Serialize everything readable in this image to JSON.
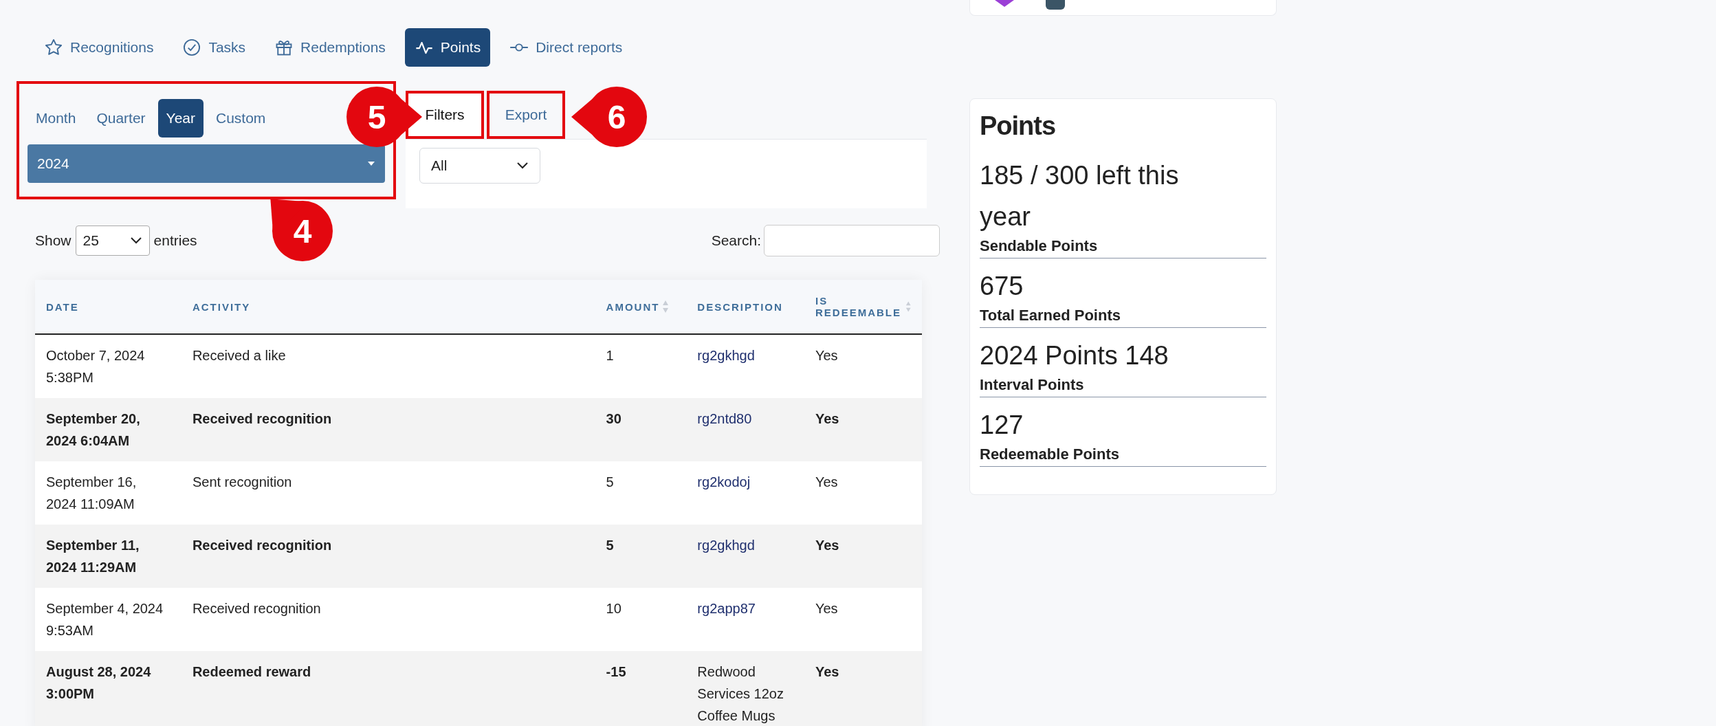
{
  "nav_tabs": [
    {
      "label": "Recognitions",
      "selected": false
    },
    {
      "label": "Tasks",
      "selected": false
    },
    {
      "label": "Redemptions",
      "selected": false
    },
    {
      "label": "Points",
      "selected": true
    },
    {
      "label": "Direct reports",
      "selected": false
    }
  ],
  "period": {
    "highlighted": true,
    "tabs": [
      {
        "label": "Month",
        "selected": false
      },
      {
        "label": "Quarter",
        "selected": false
      },
      {
        "label": "Year",
        "selected": true
      },
      {
        "label": "Custom",
        "selected": false
      }
    ],
    "value": "2024"
  },
  "panel_tabs": [
    {
      "label": "Filters",
      "selected": true,
      "highlighted": true
    },
    {
      "label": "Export",
      "selected": false,
      "highlighted": true
    }
  ],
  "filter": {
    "value": "All"
  },
  "entries": {
    "before": "Show",
    "value": "25",
    "after": "entries"
  },
  "search": {
    "label": "Search:"
  },
  "table": {
    "columns": [
      {
        "label": "DATE",
        "sortable": false
      },
      {
        "label": "ACTIVITY",
        "sortable": false
      },
      {
        "label": "AMOUNT",
        "sortable": true
      },
      {
        "label": "DESCRIPTION",
        "sortable": false
      },
      {
        "label": "IS REDEEMABLE",
        "sortable": true
      }
    ],
    "rows": [
      {
        "date": "October 7, 2024 5:38PM",
        "activity": "Received a like",
        "amount": "1",
        "description": "rg2gkhgd",
        "link": true,
        "redeemable": "Yes"
      },
      {
        "date": "September 20, 2024 6:04AM",
        "activity": "Received recognition",
        "amount": "30",
        "description": "rg2ntd80",
        "link": true,
        "redeemable": "Yes"
      },
      {
        "date": "September 16, 2024 11:09AM",
        "activity": "Sent recognition",
        "amount": "5",
        "description": "rg2kodoj",
        "link": true,
        "redeemable": "Yes"
      },
      {
        "date": "September 11, 2024 11:29AM",
        "activity": "Received recognition",
        "amount": "5",
        "description": "rg2gkhgd",
        "link": true,
        "redeemable": "Yes"
      },
      {
        "date": "September 4, 2024 9:53AM",
        "activity": "Received recognition",
        "amount": "10",
        "description": "rg2app87",
        "link": true,
        "redeemable": "Yes"
      },
      {
        "date": "August 28, 2024 3:00PM",
        "activity": "Redeemed reward",
        "amount": "-15",
        "description": "Redwood Services 12oz Coffee Mugs",
        "link": false,
        "redeemable": "Yes"
      }
    ]
  },
  "points_card": {
    "title": "Points",
    "stats": [
      {
        "value": "185 / 300 left this year",
        "label": "Sendable Points"
      },
      {
        "value": "675",
        "label": "Total Earned Points"
      },
      {
        "value": "2024 Points 148",
        "label": "Interval Points"
      },
      {
        "value": "127",
        "label": "Redeemable Points"
      }
    ]
  },
  "annotations": [
    {
      "label": "4"
    },
    {
      "label": "5"
    },
    {
      "label": "6"
    }
  ]
}
